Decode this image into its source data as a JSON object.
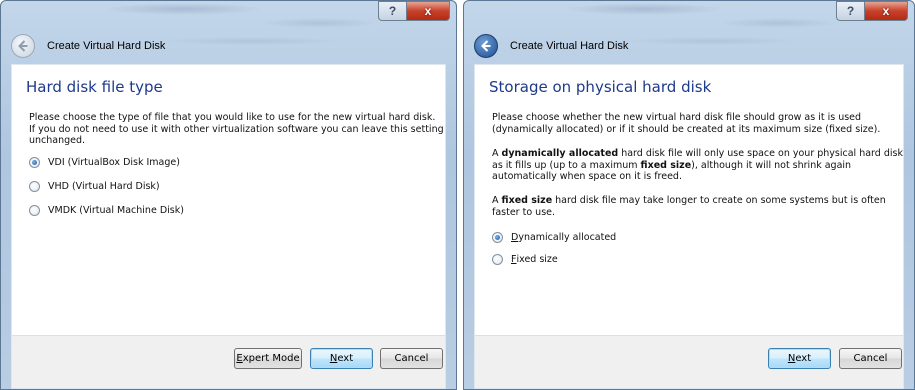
{
  "left_dialog": {
    "title": "Create Virtual Hard Disk",
    "page_title": "Hard disk file type",
    "description": "Please choose the type of file that you would like to use for the new virtual hard disk. If you do not need to use it with other virtualization software you can leave this setting unchanged.",
    "options": [
      {
        "label": "VDI (VirtualBox Disk Image)",
        "selected": true
      },
      {
        "label": "VHD (Virtual Hard Disk)",
        "selected": false
      },
      {
        "label": "VMDK (Virtual Machine Disk)",
        "selected": false
      }
    ],
    "buttons": {
      "expert_mode": {
        "prefix": "E",
        "rest": "xpert Mode"
      },
      "next": {
        "prefix": "N",
        "rest": "ext"
      },
      "cancel": "Cancel"
    },
    "caption": {
      "help": "?",
      "close": "x"
    }
  },
  "right_dialog": {
    "title": "Create Virtual Hard Disk",
    "page_title": "Storage on physical hard disk",
    "para1": "Please choose whether the new virtual hard disk file should grow as it is used (dynamically allocated) or if it should be created at its maximum size (fixed size).",
    "para2": {
      "t1": "A ",
      "b1": "dynamically allocated",
      "t2": " hard disk file will only use space on your physical hard disk as it fills up (up to a maximum ",
      "b2": "fixed size",
      "t3": "), although it will not shrink again automatically when space on it is freed."
    },
    "para3": {
      "t1": "A ",
      "b1": "fixed size",
      "t2": " hard disk file may take longer to create on some systems but is often faster to use."
    },
    "options": [
      {
        "prefix": "D",
        "rest": "ynamically allocated",
        "selected": true
      },
      {
        "prefix": "F",
        "rest": "ixed size",
        "selected": false
      }
    ],
    "buttons": {
      "next": {
        "prefix": "N",
        "rest": "ext"
      },
      "cancel": "Cancel"
    },
    "caption": {
      "help": "?",
      "close": "x"
    }
  }
}
